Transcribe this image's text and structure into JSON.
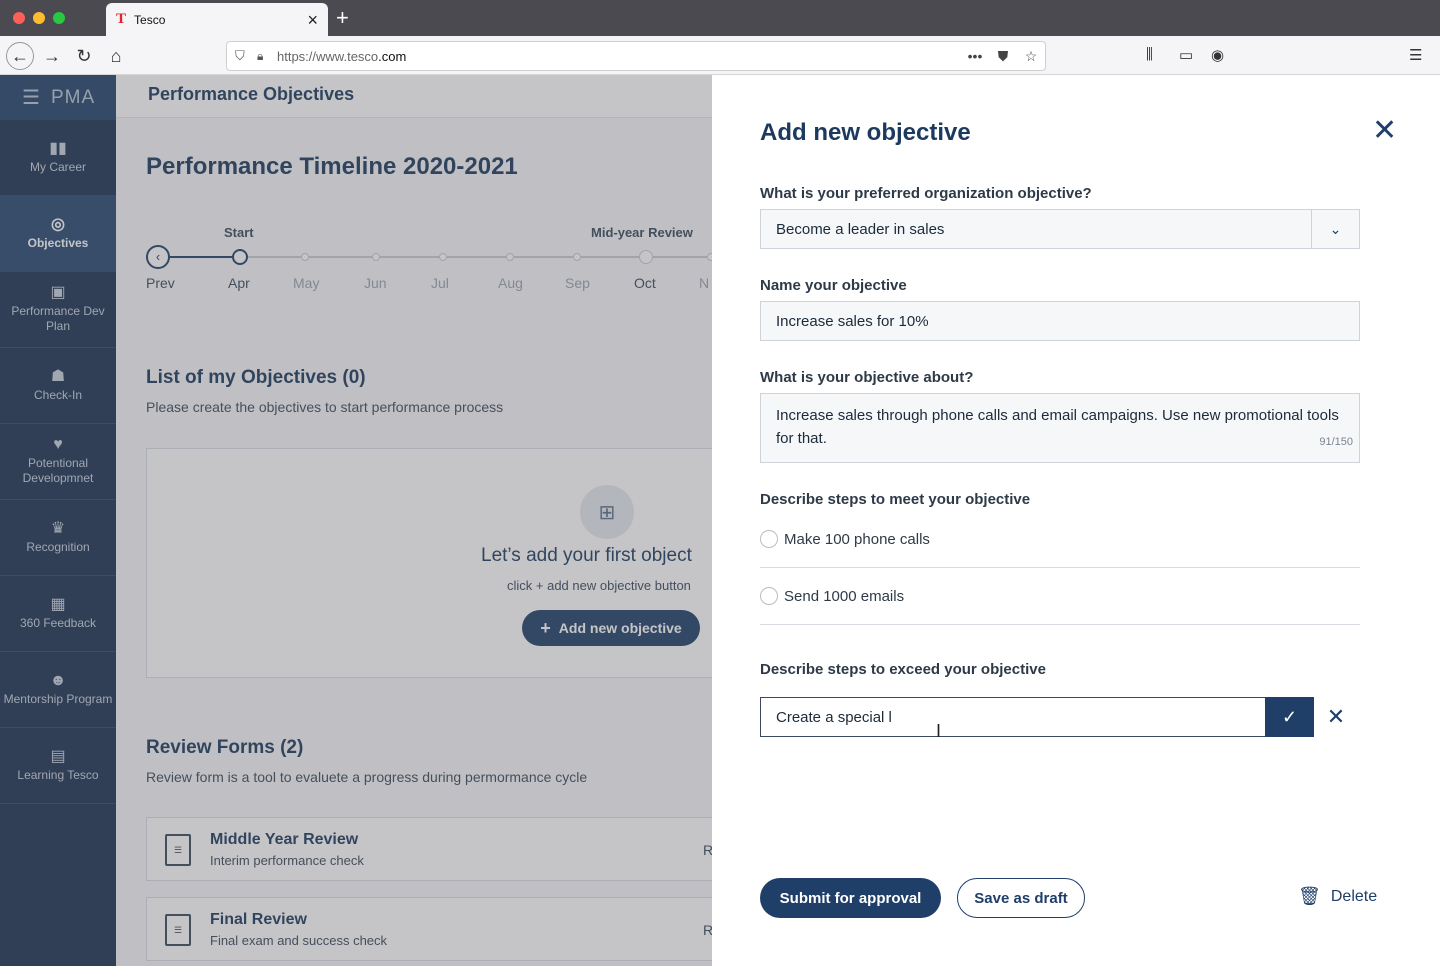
{
  "browser": {
    "tab_title": "Tesco",
    "favicon": "T",
    "url_prefix": "https://www.tesco",
    "url_domain": ".com"
  },
  "app": {
    "brand": "PMA",
    "header_title": "Performance Objectives",
    "sidebar": [
      {
        "label": "My Career",
        "icon": "bar-chart-icon",
        "glyph": "▮▮"
      },
      {
        "label": "Objectives",
        "icon": "target-icon",
        "glyph": "◎",
        "active": true
      },
      {
        "label": "Performance Dev Plan",
        "icon": "clipboard-icon",
        "glyph": "▣"
      },
      {
        "label": "Check-In",
        "icon": "checkin-icon",
        "glyph": "☗"
      },
      {
        "label": "Potentional Developmnet",
        "icon": "heart-hands-icon",
        "glyph": "♥"
      },
      {
        "label": "Recognition",
        "icon": "trophy-icon",
        "glyph": "♛"
      },
      {
        "label": "360 Feedback",
        "icon": "feedback-icon",
        "glyph": "▦"
      },
      {
        "label": "Mentorship Program",
        "icon": "mentor-icon",
        "glyph": "☻"
      },
      {
        "label": "Learning Tesco",
        "icon": "book-icon",
        "glyph": "▤"
      }
    ]
  },
  "timeline": {
    "title": "Performance Timeline 2020-2021",
    "start_label": "Start",
    "midyear_label": "Mid-year Review",
    "months": [
      "Prev",
      "Apr",
      "May",
      "Jun",
      "Jul",
      "Aug",
      "Sep",
      "Oct",
      "N"
    ]
  },
  "objectives_list": {
    "title": "List of my Objectives (0)",
    "subtitle": "Please create the objectives to start performance process",
    "empty_title": "Let’s add your first object",
    "empty_subtitle": "click + add new objective button",
    "add_button": "Add new objective"
  },
  "review_forms": {
    "title": "Review Forms (2)",
    "subtitle": "Review form is a tool to evaluete a progress during permormance cycle",
    "items": [
      {
        "title": "Middle Year Review",
        "subtitle": "Interim performance check",
        "right": "R"
      },
      {
        "title": "Final Review",
        "subtitle": "Final exam and success check",
        "right": "R"
      }
    ]
  },
  "panel": {
    "title": "Add new objective",
    "org_label": "What is your preferred organization objective?",
    "org_value": "Become a leader in sales",
    "name_label": "Name your objective",
    "name_value": "Increase sales for 10%",
    "about_label": "What is your objective about?",
    "about_value": "Increase sales through phone calls and email campaigns. Use new promotional tools for that.",
    "about_counter": "91/150",
    "meet_label": "Describe steps to meet your objective",
    "meet_steps": [
      "Make 100 phone calls",
      "Send 1000 emails"
    ],
    "exceed_label": "Describe steps to exceed your objective",
    "exceed_value": "Create a special l",
    "submit_button": "Submit for approval",
    "draft_button": "Save as draft",
    "delete_button": "Delete"
  }
}
